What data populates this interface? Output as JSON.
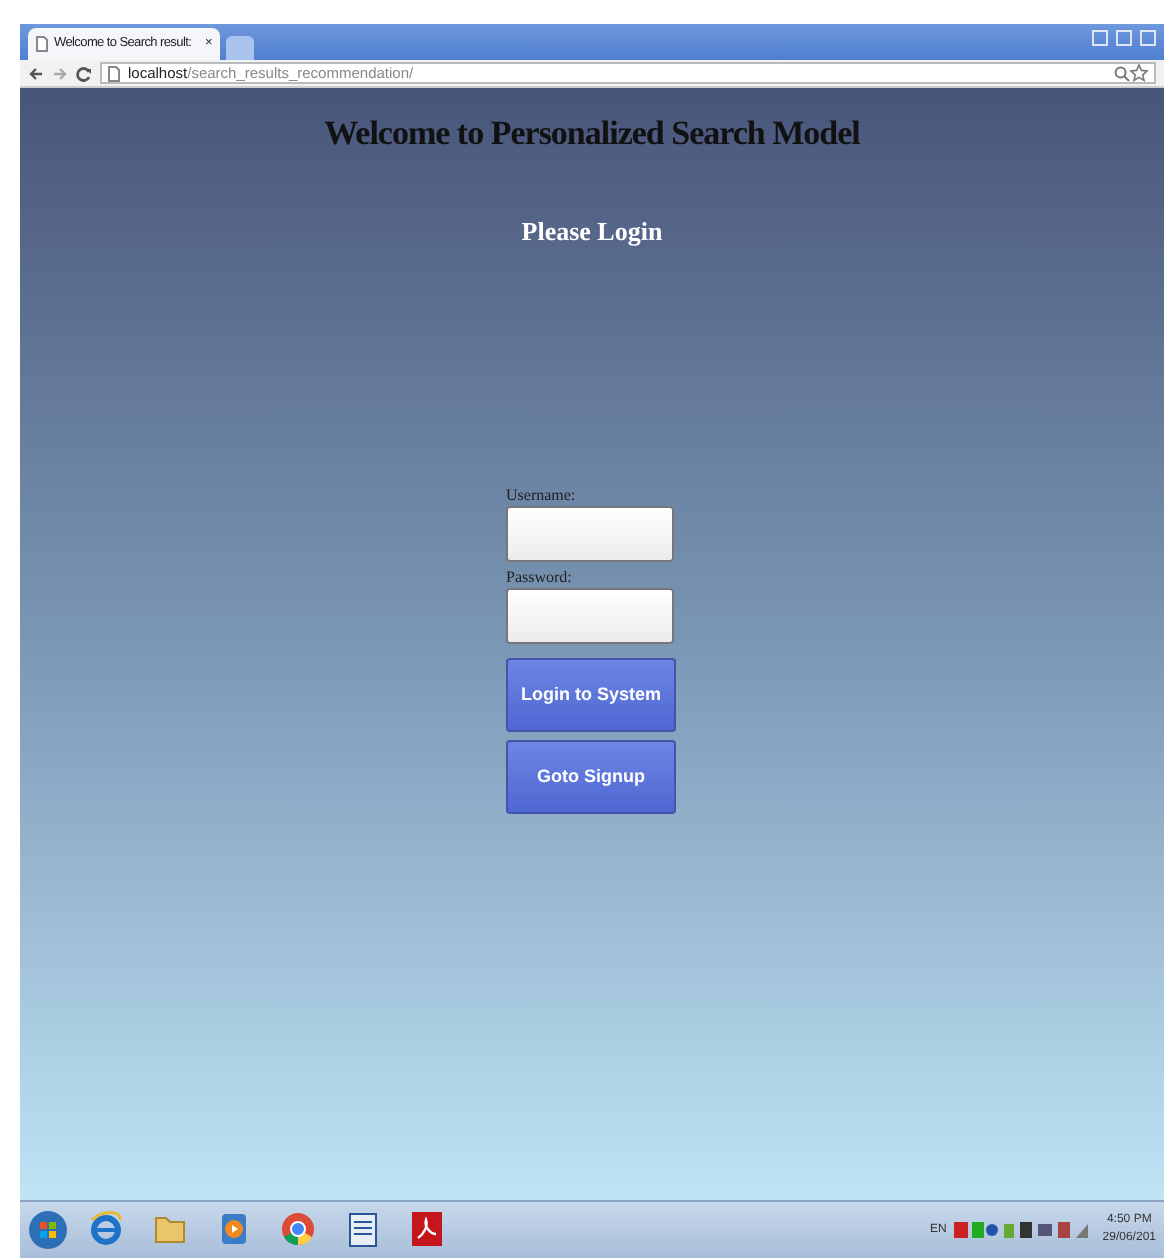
{
  "browser": {
    "tab": {
      "title": "Welcome to Search result:",
      "close": "×",
      "selected": true
    },
    "address": {
      "host": "localhost",
      "path": "/search_results_recommendation/"
    }
  },
  "page": {
    "heading": "Welcome to Personalized Search Model",
    "subheading": "Please Login",
    "fields": [
      {
        "label": "Username:"
      },
      {
        "label": "Password:"
      }
    ],
    "buttons": [
      "Login to System",
      "Goto Signup"
    ]
  },
  "taskbar": {
    "language": "EN",
    "time": "4:50 PM",
    "date": "29/06/201"
  }
}
